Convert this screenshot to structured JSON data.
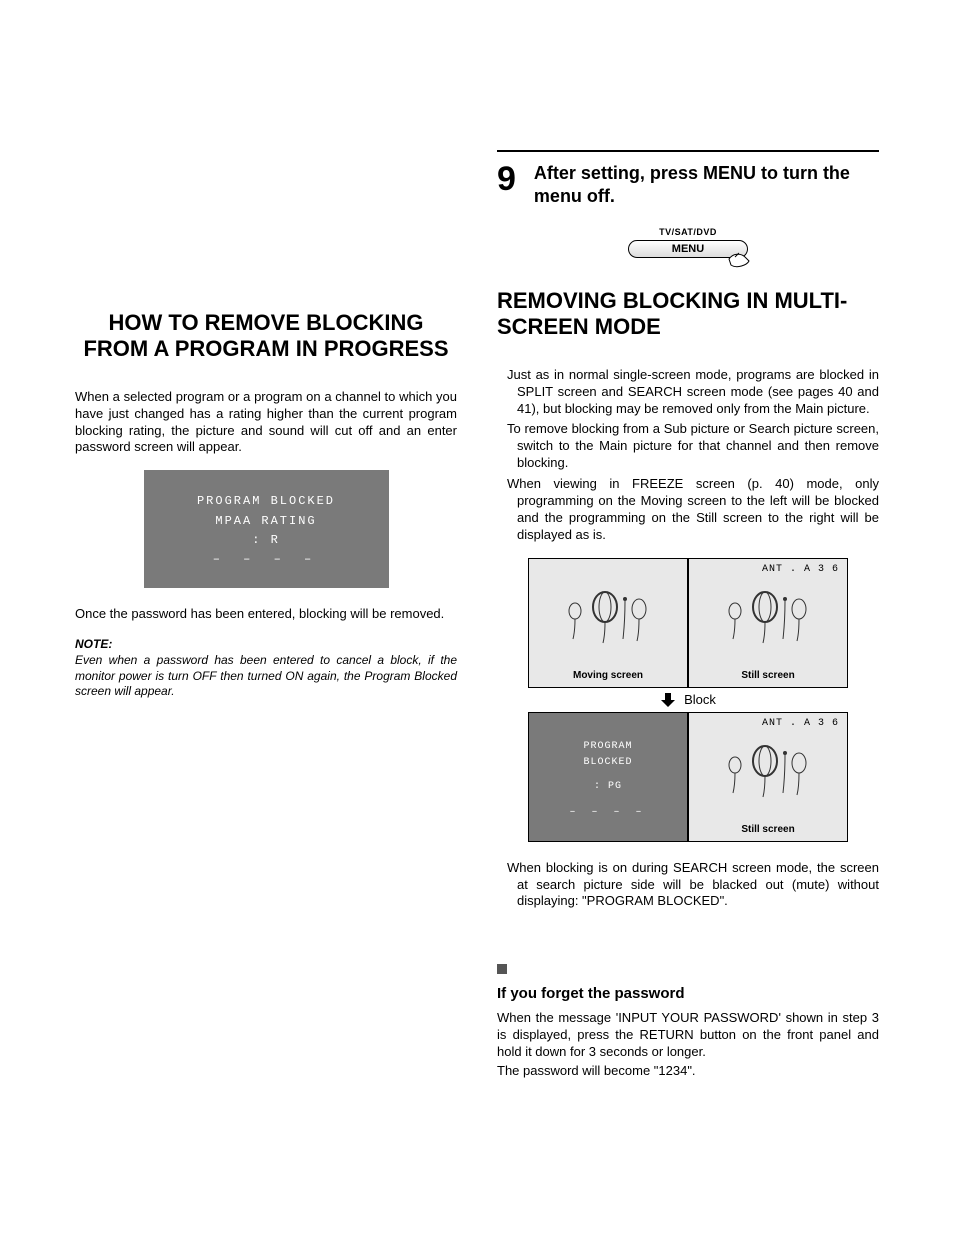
{
  "step": {
    "number": "9",
    "text": "After setting, press MENU to turn the menu off.",
    "button_top_label": "TV/SAT/DVD",
    "button_label": "MENU"
  },
  "left": {
    "heading": "HOW TO REMOVE BLOCKING FROM A PROGRAM IN PROGRESS",
    "p1": "When a selected program or a program on a channel to which you have just changed has a rating higher than the current program blocking rating, the picture and sound will cut off and an enter password screen will appear.",
    "osd": {
      "line1": "PROGRAM BLOCKED",
      "line2": "MPAA  RATING",
      "line3": ": R",
      "dashes": "–   –   –   –"
    },
    "p2": "Once the password has been entered, blocking will be removed.",
    "note_label": "NOTE:",
    "note_body": "Even when a password has been entered to cancel a block, if the monitor power is turn OFF then turned ON again, the Program Blocked screen will appear."
  },
  "right": {
    "heading": "REMOVING BLOCKING IN MULTI-SCREEN MODE",
    "list": {
      "i1": "Just as in normal single-screen mode, programs are blocked in SPLIT screen and SEARCH screen mode (see pages 40 and 41), but blocking may be removed only from the Main picture.",
      "i2": "To remove blocking from a Sub picture or Search picture screen, switch to the Main picture for that channel and then remove blocking.",
      "i3": "When viewing in FREEZE screen (p. 40) mode, only programming on the Moving screen to the left will be blocked and the programming on the Still screen to the right will be displayed as is."
    },
    "diagram": {
      "ant_label": "ANT . A  3 6",
      "moving_label": "Moving screen",
      "still_label": "Still screen",
      "block_label": "Block",
      "blocked": {
        "line1": "PROGRAM",
        "line2": "BLOCKED",
        "rating": ": PG",
        "dashes": "–  –  –  –"
      }
    },
    "after_diagram": "When blocking is on during SEARCH screen mode, the screen at search picture side will be blacked out (mute) without displaying: \"PROGRAM BLOCKED\".",
    "forgot_heading": "If you forget the password",
    "forgot_p1": "When the message 'INPUT YOUR PASSWORD' shown in step 3 is displayed, press the RETURN button on the front panel and hold it down for 3 seconds or longer.",
    "forgot_p2": "The password will become \"1234\"."
  }
}
